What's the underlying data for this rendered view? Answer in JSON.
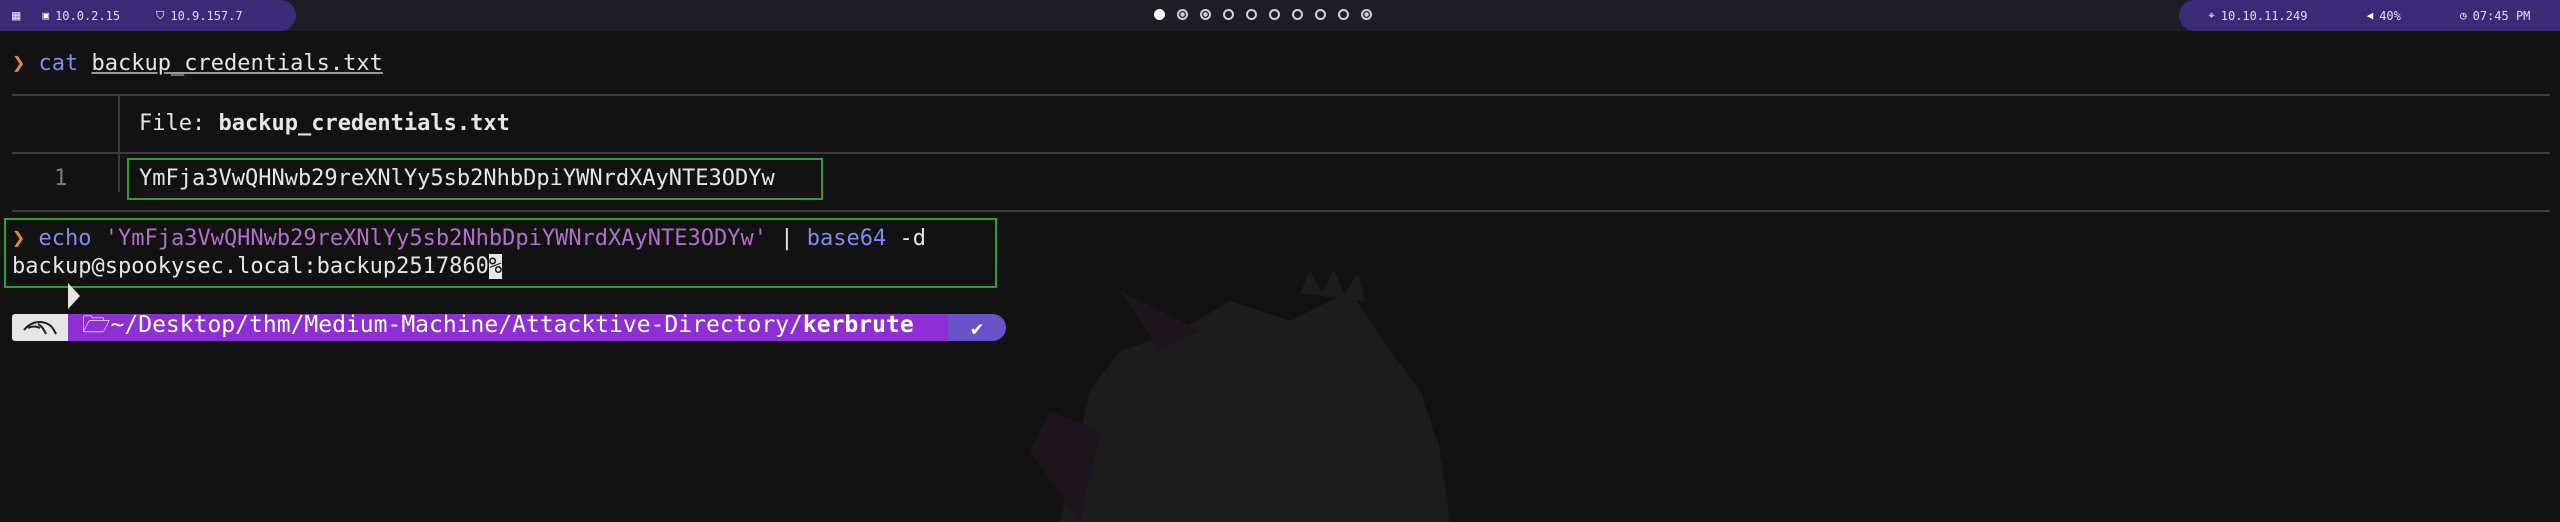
{
  "topbar": {
    "menu_icon": "grid-icon",
    "ip_local_1": "10.0.2.15",
    "ip_local_2": "10.9.157.7",
    "workspaces": [
      "active",
      "occupied",
      "occupied",
      "empty",
      "empty",
      "empty",
      "empty",
      "empty",
      "empty",
      "occupied"
    ],
    "target_ip": "10.10.11.249",
    "volume": "40%",
    "time": "07:45 PM",
    "icons": {
      "monitor": "monitor-icon",
      "shield": "shield-icon",
      "target": "crosshair-icon",
      "volume": "speaker-icon",
      "clock": "clock-icon"
    }
  },
  "terminal": {
    "prompt_symbol": "❯",
    "cmd1": {
      "command": "cat",
      "argument": "backup_credentials.txt"
    },
    "bat": {
      "file_label": "File: ",
      "file_name": "backup_credentials.txt",
      "line_number": "1",
      "content": "YmFja3VwQHNwb29reXNlYy5sb2NhbDpiYWNrdXAyNTE3ODYw"
    },
    "cmd2": {
      "command": "echo",
      "string": "'YmFja3VwQHNwb29reXNlYy5sb2NhbDpiYWNrdXAyNTE3ODYw'",
      "pipe": "|",
      "tool": "base64",
      "flag": "-d"
    },
    "output": "backup@spookysec.local:backup2517860",
    "cursor": "%",
    "prompt_path": {
      "folder_icon": "folder-open-icon",
      "dir": "~/Desktop/thm/Medium-Machine/Attacktive-Directory/",
      "current": "kerbrute",
      "status": "✔"
    }
  },
  "colors": {
    "accent_purple": "#8e2fd6",
    "highlight_green": "#2f9e2f",
    "prompt_orange": "#e08a2a",
    "command_blue": "#7c8cf0"
  }
}
